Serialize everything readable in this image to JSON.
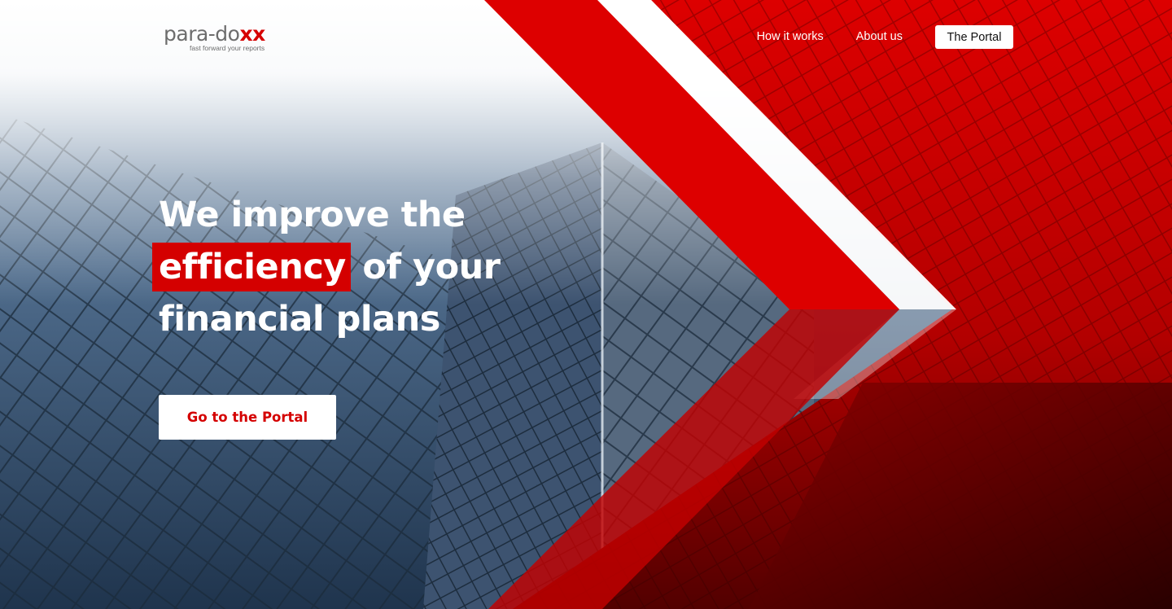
{
  "brand": {
    "name_prefix": "para-do",
    "name_suffix": "xx",
    "tagline": "fast forward your reports",
    "accent_color": "#d40000"
  },
  "nav": {
    "how_it_works": "How it works",
    "about_us": "About us",
    "portal_button": "The Portal"
  },
  "hero": {
    "headline_line1": "We improve the",
    "headline_highlight": "efficiency",
    "headline_line2_rest": " of your",
    "headline_line3": "financial plans",
    "cta_label": "Go to the Portal"
  }
}
